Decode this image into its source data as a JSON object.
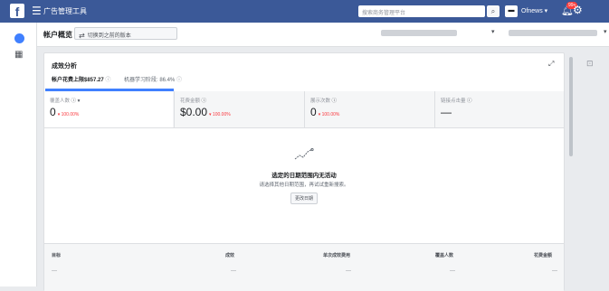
{
  "topbar": {
    "logo": "f",
    "menu_icon": "☰",
    "title": "广告管理工具",
    "search_placeholder": "搜索商务管理平台",
    "search_icon": "🔍",
    "account_logo": "Ofnews",
    "account_name": "Ofnews ▾",
    "notif_count": "99+",
    "bell_icon": "bell-icon",
    "gear_icon": "gear-icon"
  },
  "header": {
    "title": "帐户概览",
    "switch_label": "切换到之前的版本",
    "more_label": "···",
    "dropdown_arrow": "▾"
  },
  "card": {
    "title": "成效分析",
    "tabs": [
      {
        "label": "帐户花费上限$857.27",
        "info": "ⓘ"
      },
      {
        "label": "机器学习阶段: 86.4%",
        "info": "ⓘ"
      }
    ],
    "metrics": [
      {
        "label": "覆盖人数",
        "value": "0",
        "change": "▾ 100.00%"
      },
      {
        "label": "花费金额",
        "value": "$0.00",
        "change": "▾ 100.00%"
      },
      {
        "label": "展示次数",
        "value": "0",
        "change": "▾ 100.00%"
      },
      {
        "label": "链接点击量",
        "value": "—",
        "change": ""
      }
    ],
    "empty_state": {
      "title": "选定的日期范围内无活动",
      "description": "请选择其他日期范围，再试试重新搜索。",
      "button": "更改日期"
    },
    "table": {
      "headers": [
        "目标",
        "成效",
        "单次成效费用",
        "覆盖人数",
        "花费金额"
      ],
      "row": [
        "—",
        "—",
        "—",
        "—",
        "—"
      ]
    }
  },
  "colors": {
    "brand": "#3b5998",
    "accent": "#4080ff",
    "negative": "#fa383e"
  }
}
